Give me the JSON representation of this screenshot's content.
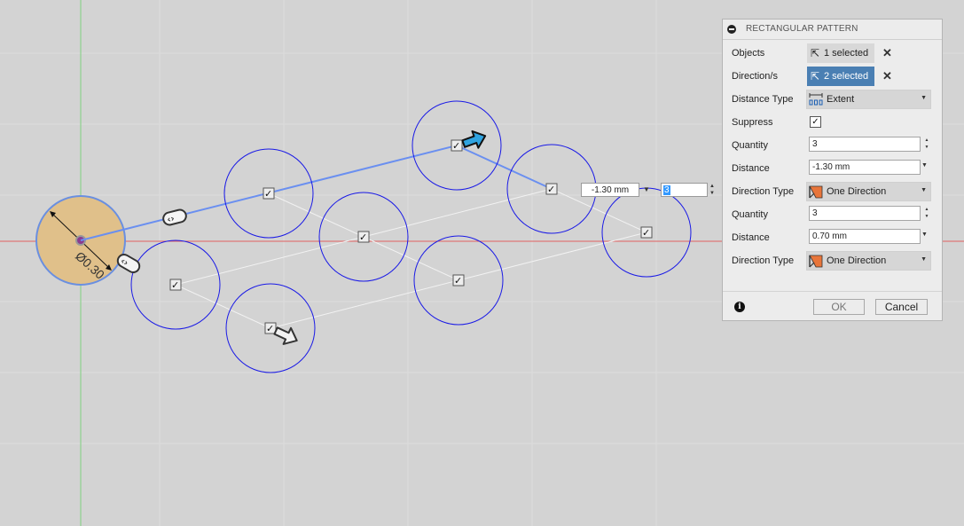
{
  "canvas": {
    "dimension_label": "Ø0.30",
    "float_distance_value": "-1.30 mm",
    "float_quantity_value": "3"
  },
  "dialog": {
    "title": "RECTANGULAR PATTERN",
    "objects": {
      "label": "Objects",
      "value": "1 selected"
    },
    "directions": {
      "label": "Direction/s",
      "value": "2 selected"
    },
    "distance_type": {
      "label": "Distance Type",
      "value": "Extent"
    },
    "suppress": {
      "label": "Suppress",
      "checked": true
    },
    "dir1": {
      "quantity_label": "Quantity",
      "quantity": "3",
      "distance_label": "Distance",
      "distance": "-1.30 mm",
      "direction_type_label": "Direction Type",
      "direction_type": "One Direction"
    },
    "dir2": {
      "quantity_label": "Quantity",
      "quantity": "3",
      "distance_label": "Distance",
      "distance": "0.70 mm",
      "direction_type_label": "Direction Type",
      "direction_type": "One Direction"
    },
    "ok_label": "OK",
    "cancel_label": "Cancel"
  },
  "colors": {
    "background": "#d3d3d3",
    "circle_stroke": "#1a1ae6",
    "seed_fill": "#e0c08a",
    "selected_button": "#4a7fb3",
    "x_axis": "#e06060",
    "y_axis": "#7fd07f",
    "arrow_blue": "#2fa3e0"
  }
}
